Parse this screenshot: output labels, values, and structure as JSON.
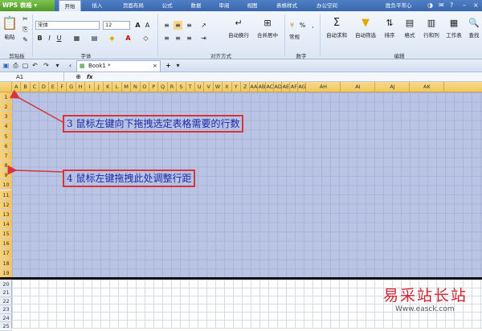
{
  "menubar": {
    "app_label": "WPS 表格",
    "tabs": [
      "开始",
      "插入",
      "页面布局",
      "公式",
      "数据",
      "审阅",
      "视图",
      "表格样式",
      "办公空间"
    ],
    "active_tab": "开始",
    "user_label": "胜负平常心"
  },
  "ribbon": {
    "paste_label": "粘贴",
    "clipboard_label": "剪贴板",
    "font_name": "宋体",
    "font_size": "12",
    "font_group_label": "字体",
    "align_group_label": "对齐方式",
    "wrap_label": "自动换行",
    "merge_label": "合并居中",
    "number_group_label": "数字",
    "number_format": "常规",
    "autosum_label": "自动求和",
    "filter_label": "自动筛选",
    "sort_label": "排序",
    "format_label": "格式",
    "rowcol_label": "行和列",
    "sheet_label": "工作表",
    "find_label": "查找",
    "edit_group_label": "编辑"
  },
  "quickbar": {
    "doc_tab": "Book1 *"
  },
  "formula_bar": {
    "cell_ref": "A1",
    "fx_label": "fx",
    "formula": ""
  },
  "grid": {
    "columns": [
      "A",
      "B",
      "C",
      "D",
      "E",
      "F",
      "G",
      "H",
      "I",
      "J",
      "K",
      "L",
      "M",
      "N",
      "O",
      "P",
      "Q",
      "R",
      "S",
      "T",
      "U",
      "V",
      "W",
      "X",
      "Y",
      "Z",
      "AA",
      "AB",
      "AC",
      "AD",
      "AE",
      "AF",
      "AG",
      "AH",
      "AI",
      "AJ",
      "AK"
    ],
    "rows": [
      "1",
      "2",
      "3",
      "4",
      "5",
      "6",
      "7",
      "8",
      "9",
      "10",
      "11",
      "12",
      "13",
      "14",
      "15",
      "16",
      "17",
      "18",
      "19",
      "20",
      "21",
      "22",
      "23",
      "24",
      "25"
    ]
  },
  "annotations": {
    "note1": "3  鼠标左键向下拖拽选定表格需要的行数",
    "note2": "4  鼠标左键拖拽此处调整行距"
  },
  "colors": {
    "selection": "#b9c3e4",
    "annotation_border": "#d9343a",
    "annotation_text": "#1c2aa8",
    "arrow": "#d9343a"
  },
  "watermark": {
    "text": "易采站长站",
    "url": "Www.easck.com"
  }
}
